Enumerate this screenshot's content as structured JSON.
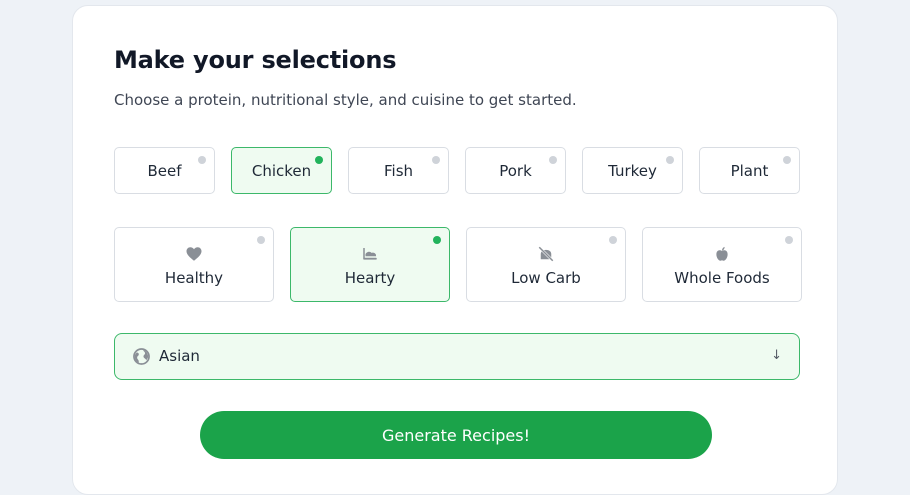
{
  "form": {
    "title": "Make your selections",
    "subtitle": "Choose a protein, nutritional style, and cuisine to get started."
  },
  "proteins": [
    {
      "label": "Beef",
      "selected": false
    },
    {
      "label": "Chicken",
      "selected": true
    },
    {
      "label": "Fish",
      "selected": false
    },
    {
      "label": "Pork",
      "selected": false
    },
    {
      "label": "Turkey",
      "selected": false
    },
    {
      "label": "Plant",
      "selected": false
    }
  ],
  "styles": [
    {
      "label": "Healthy",
      "icon": "heart-icon",
      "selected": false
    },
    {
      "label": "Hearty",
      "icon": "hearty-meal-icon",
      "selected": true
    },
    {
      "label": "Low Carb",
      "icon": "no-bread-icon",
      "selected": false
    },
    {
      "label": "Whole Foods",
      "icon": "apple-icon",
      "selected": false
    }
  ],
  "cuisine": {
    "icon": "globe-icon",
    "value": "Asian",
    "dropdown_arrow": "↓"
  },
  "generate_button": {
    "label": "Generate Recipes!"
  },
  "colors": {
    "accent": "#1ba34a",
    "selected_bg": "#effbf1",
    "selected_border": "#3cb86a",
    "indicator_on": "#22b35c",
    "indicator_off": "#cfd3d9"
  }
}
